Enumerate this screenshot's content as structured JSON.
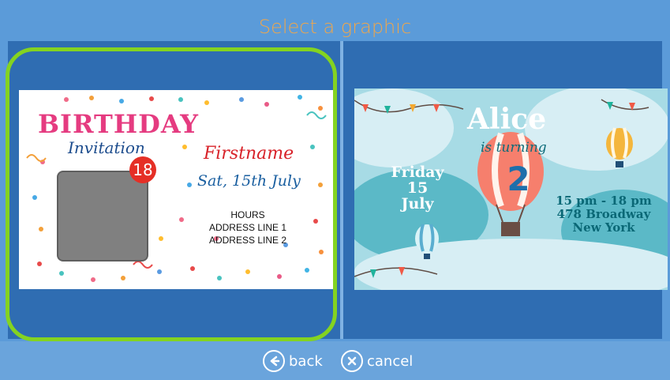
{
  "header": {
    "title": "Select a graphic"
  },
  "graphics": [
    {
      "name": "birthday",
      "title": "BIRTHDAY",
      "subtitle": "Invitation",
      "age": "18",
      "firstname": "Firstname",
      "date": "Sat, 15th July",
      "info": [
        "HOURS",
        "ADDRESS LINE 1",
        "ADDRESS LINE 2"
      ]
    },
    {
      "name": "alice",
      "title": "Alice",
      "subtitle": "is turning",
      "age": "2",
      "date_lines": [
        "Friday",
        "15",
        "July"
      ],
      "info": [
        "15 pm - 18 pm",
        "478 Broadway",
        "New York"
      ]
    }
  ],
  "footer": {
    "back_label": "back",
    "cancel_label": "cancel"
  },
  "colors": {
    "selection_ring": "#84d321",
    "header_text": "#f0a64a",
    "panel": "#2f6db2",
    "background": "#5b9bd9"
  }
}
